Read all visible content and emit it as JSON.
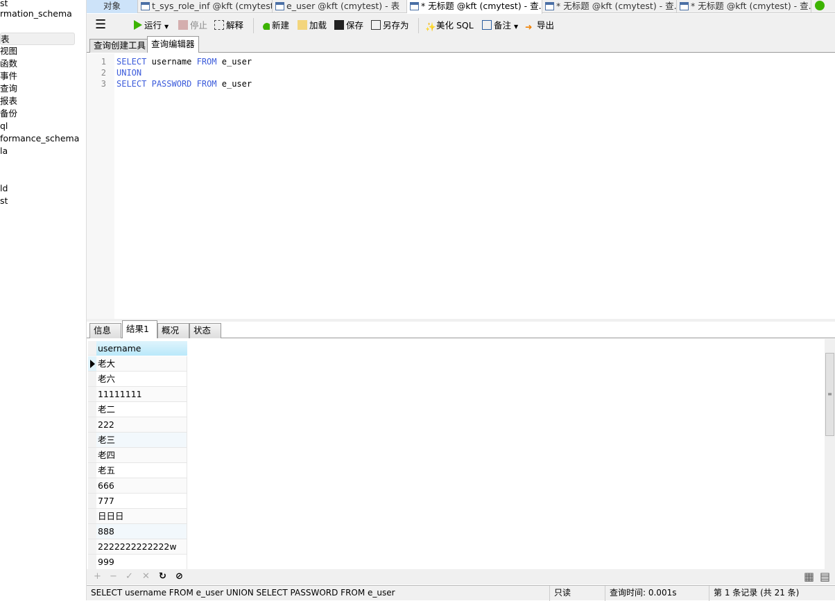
{
  "sidebar": {
    "items": [
      {
        "label": "st"
      },
      {
        "label": "rmation_schema"
      },
      {
        "label": "表",
        "selected": true
      },
      {
        "label": "视图"
      },
      {
        "label": "函数"
      },
      {
        "label": "事件"
      },
      {
        "label": "查询"
      },
      {
        "label": "报表"
      },
      {
        "label": "备份"
      },
      {
        "label": "ql"
      },
      {
        "label": "formance_schema"
      },
      {
        "label": "la"
      },
      {
        "label": "ld"
      },
      {
        "label": "st"
      }
    ]
  },
  "tabs": [
    {
      "label": "对象",
      "active": false
    },
    {
      "label": "t_sys_role_inf @kft (cmytest..."
    },
    {
      "label": "e_user @kft (cmytest) - 表"
    },
    {
      "label": "* 无标题 @kft (cmytest) - 查...",
      "active": true
    },
    {
      "label": "* 无标题 @kft (cmytest) - 查..."
    },
    {
      "label": "* 无标题 @kft (cmytest) - 查..."
    }
  ],
  "toolbar": {
    "run": "运行",
    "stop": "停止",
    "explain": "解释",
    "new": "新建",
    "load": "加载",
    "save": "保存",
    "save_as": "另存为",
    "beautify": "美化 SQL",
    "comment": "备注",
    "export": "导出"
  },
  "subtabs": [
    {
      "label": "查询创建工具"
    },
    {
      "label": "查询编辑器",
      "active": true
    }
  ],
  "editor": {
    "lines": [
      {
        "num": "1",
        "tokens": [
          {
            "t": "SELECT",
            "kw": true
          },
          {
            "t": " username "
          },
          {
            "t": "FROM",
            "kw": true
          },
          {
            "t": " e_user"
          }
        ]
      },
      {
        "num": "2",
        "tokens": [
          {
            "t": "UNION",
            "kw": true
          }
        ]
      },
      {
        "num": "3",
        "tokens": [
          {
            "t": "SELECT",
            "kw": true
          },
          {
            "t": " "
          },
          {
            "t": "PASSWORD",
            "kw": true
          },
          {
            "t": " "
          },
          {
            "t": "FROM",
            "kw": true
          },
          {
            "t": " e_user"
          }
        ]
      }
    ]
  },
  "result_tabs": [
    {
      "label": "信息"
    },
    {
      "label": "结果1",
      "active": true
    },
    {
      "label": "概况"
    },
    {
      "label": "状态"
    }
  ],
  "grid": {
    "column": "username",
    "rows": [
      "老大",
      "老六",
      "11111111",
      "老二",
      "222",
      "老三",
      "老四",
      "老五",
      "666",
      "777",
      "日日日",
      "888",
      "2222222222222w",
      "999"
    ]
  },
  "status": {
    "sql": "SELECT username FROM e_user UNION SELECT PASSWORD FROM e_user",
    "mode": "只读",
    "query_time": "查询时间: 0.001s",
    "record": "第 1 条记录 (共 21 条)"
  }
}
